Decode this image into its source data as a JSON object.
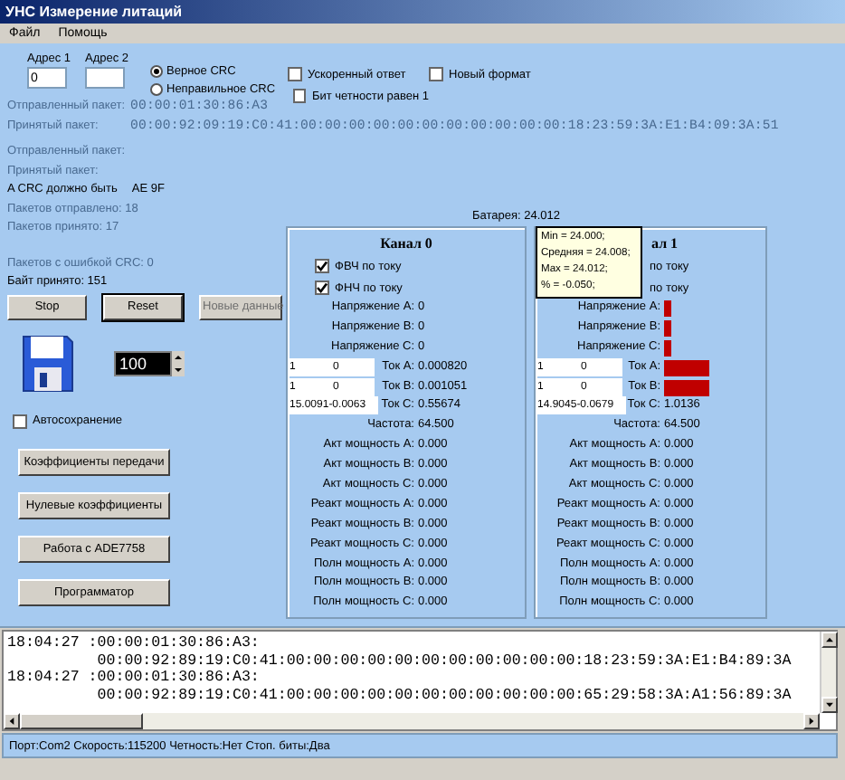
{
  "window": {
    "title": "УНС Измерение литаций"
  },
  "menu": [
    "Файл",
    "Помощь"
  ],
  "address_fields": [
    {
      "label": "Адрес 1",
      "value": "0"
    },
    {
      "label": "Адрес 2"
    }
  ],
  "crc_options": [
    {
      "label": "Верное CRC",
      "selected": true
    },
    {
      "label": "Неправильное CRC",
      "selected": false
    }
  ],
  "options": [
    {
      "label": "Ускоренный ответ",
      "checked": false
    },
    {
      "label": "Бит четности равен 1",
      "checked": false
    },
    {
      "label": "Новый формат",
      "checked": false
    }
  ],
  "packets": [
    {
      "label": "Отправленный пакет:",
      "value": "00:00:01:30:86:A3",
      "faded": true
    },
    {
      "label": "Принятый пакет:",
      "value": "00:00:92:09:19:C0:41:00:00:00:00:00:00:00:00:00:00:00:18:23:59:3A:E1:B4:09:3A:51",
      "faded": true
    }
  ],
  "info_lines": [
    {
      "label": "Отправленный пакет:",
      "faded": true
    },
    {
      "label": "Принятый пакет:",
      "faded": true
    },
    {
      "label": "A CRC должно быть",
      "value": "AE 9F",
      "faded": false
    },
    {
      "label": "Пакетов отправлено: 18",
      "faded": true
    },
    {
      "label": "Пакетов принято: 17",
      "faded": true
    }
  ],
  "error_lines": [
    {
      "label": "Пакетов с ошибкой CRC: 0",
      "faded": true
    },
    {
      "label": "Байт принято: 151",
      "faded": false
    }
  ],
  "control_buttons": [
    {
      "label": "Stop",
      "disabled": false,
      "focused": false
    },
    {
      "label": "Reset",
      "disabled": false,
      "focused": true
    },
    {
      "label": "Новые данные",
      "disabled": true,
      "focused": false
    }
  ],
  "save_interval": {
    "value": "100"
  },
  "autosave": {
    "label": "Автосохранение",
    "checked": false
  },
  "actions": [
    "Коэффициенты передачи",
    "Нулевые коэффициенты",
    "Работа с ADE7758",
    "Программатор"
  ],
  "battery": "Батарея: 24.012",
  "channels": [
    {
      "title": "Канал 0",
      "filters": [
        {
          "label": "ФВЧ по току",
          "checked": true
        },
        {
          "label": "ФНЧ по току",
          "checked": true
        }
      ],
      "rows": [
        {
          "label": "Напряжение A:",
          "value": "0",
          "alarm": false
        },
        {
          "label": "Напряжение B:",
          "value": "0",
          "alarm": false
        },
        {
          "label": "Напряжение C:",
          "value": "0",
          "alarm": false
        },
        {
          "label": "Ток A:",
          "value": "0.000820",
          "alarm": false,
          "inputs": [
            "1",
            "0"
          ]
        },
        {
          "label": "Ток B:",
          "value": "0.001051",
          "alarm": false,
          "inputs": [
            "1",
            "0"
          ]
        },
        {
          "label": "Ток C:",
          "value": "0.55674",
          "alarm": false,
          "inputs": [
            "15.0091-0.0063"
          ]
        },
        {
          "label": "Частота:",
          "value": "64.500",
          "alarm": false
        },
        {
          "label": "Акт мощность A:",
          "value": "0.000",
          "alarm": false
        },
        {
          "label": "Акт мощность B:",
          "value": "0.000",
          "alarm": false
        },
        {
          "label": "Акт мощность C:",
          "value": "0.000",
          "alarm": false
        },
        {
          "label": "Реакт мощность A:",
          "value": "0.000",
          "alarm": false
        },
        {
          "label": "Реакт мощность B:",
          "value": "0.000",
          "alarm": false
        },
        {
          "label": "Реакт мощность C:",
          "value": "0.000",
          "alarm": false
        },
        {
          "label": "Полн мощность A:",
          "value": "0.000",
          "alarm": false
        },
        {
          "label": "Полн мощность B:",
          "value": "0.000",
          "alarm": false
        },
        {
          "label": "Полн мощность C:",
          "value": "0.000",
          "alarm": false
        }
      ]
    },
    {
      "title": "ал 1",
      "filters": [
        {
          "label": "по току"
        },
        {
          "label": "по току"
        }
      ],
      "rows": [
        {
          "label": "Напряжение A:",
          "alarm": true
        },
        {
          "label": "Напряжение B:",
          "alarm": true
        },
        {
          "label": "Напряжение C:",
          "alarm": true
        },
        {
          "label": "Ток A:",
          "alarm": true,
          "inputs": [
            "1",
            "0"
          ]
        },
        {
          "label": "Ток B:",
          "alarm": true,
          "inputs": [
            "1",
            "0"
          ]
        },
        {
          "label": "Ток C:",
          "value": "1.0136",
          "alarm": false,
          "inputs": [
            "14.9045-0.0679"
          ]
        },
        {
          "label": "Частота:",
          "value": "64.500",
          "alarm": false
        },
        {
          "label": "Акт мощность A:",
          "value": "0.000",
          "alarm": false
        },
        {
          "label": "Акт мощность B:",
          "value": "0.000",
          "alarm": false
        },
        {
          "label": "Акт мощность C:",
          "value": "0.000",
          "alarm": false
        },
        {
          "label": "Реакт мощность A:",
          "value": "0.000",
          "alarm": false
        },
        {
          "label": "Реакт мощность B:",
          "value": "0.000",
          "alarm": false
        },
        {
          "label": "Реакт мощность C:",
          "value": "0.000",
          "alarm": false
        },
        {
          "label": "Полн мощность A:",
          "value": "0.000",
          "alarm": false
        },
        {
          "label": "Полн мощность B:",
          "value": "0.000",
          "alarm": false
        },
        {
          "label": "Полн мощность C:",
          "value": "0.000",
          "alarm": false
        }
      ]
    }
  ],
  "tooltip": {
    "lines": [
      "Min = 24.000;",
      "Средняя = 24.008;",
      "Max = 24.012;",
      "% = -0.050;"
    ]
  },
  "log": {
    "lines": [
      "18:04:27 :00:00:01:30:86:A3:",
      "          00:00:92:89:19:C0:41:00:00:00:00:00:00:00:00:00:00:00:18:23:59:3A:E1:B4:89:3A",
      "18:04:27 :00:00:01:30:86:A3:",
      "          00:00:92:89:19:C0:41:00:00:00:00:00:00:00:00:00:00:00:65:29:58:3A:A1:56:89:3A"
    ]
  },
  "status_bar": "Порт:Com2 Скорость:115200 Четность:Нет Стоп. биты:Два"
}
